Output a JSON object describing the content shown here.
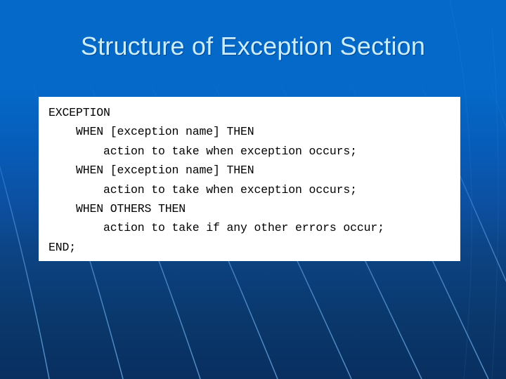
{
  "slide": {
    "title": "Structure of Exception Section",
    "theme": {
      "background_top": "#0569c9",
      "background_bottom": "#092f5f",
      "title_color": "#c9eefa",
      "grid_line_color": "#3a86d8",
      "card_background": "#ffffff",
      "code_color": "#000000"
    }
  },
  "code": {
    "language": "plsql",
    "lines": [
      "EXCEPTION",
      "    WHEN [exception name] THEN",
      "        action to take when exception occurs;",
      "    WHEN [exception name] THEN",
      "        action to take when exception occurs;",
      "    WHEN OTHERS THEN",
      "        action to take if any other errors occur;",
      "END;"
    ],
    "full_text": "EXCEPTION\n    WHEN [exception name] THEN\n        action to take when exception occurs;\n    WHEN [exception name] THEN\n        action to take when exception occurs;\n    WHEN OTHERS THEN\n        action to take if any other errors occur;\nEND;"
  }
}
